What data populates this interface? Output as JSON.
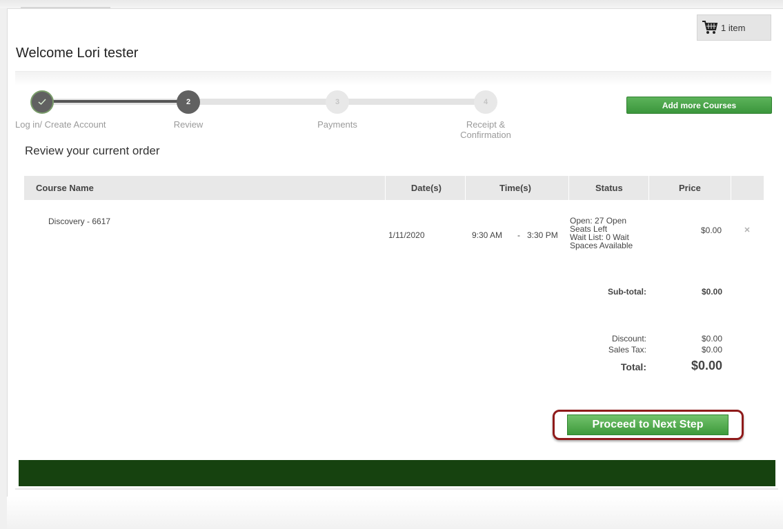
{
  "cart": {
    "count_label": "1 item"
  },
  "welcome": "Welcome Lori tester",
  "steps": [
    {
      "number": "",
      "label": "Log in/ Create Account",
      "state": "done"
    },
    {
      "number": "2",
      "label": "Review",
      "state": "current"
    },
    {
      "number": "3",
      "label": "Payments",
      "state": "todo"
    },
    {
      "number": "4",
      "label_line1": "Receipt &",
      "label_line2": "Confirmation",
      "state": "todo"
    }
  ],
  "add_courses_label": "Add more Courses",
  "review_heading": "Review your current order",
  "table": {
    "headers": [
      "Course Name",
      "Date(s)",
      "Time(s)",
      "Status",
      "Price"
    ],
    "row": {
      "course": "Discovery - 6617",
      "date": "1/11/2020",
      "time_start": "9:30 AM",
      "time_sep": "-",
      "time_end": "3:30 PM",
      "status_lines": [
        "Open: 27 Open",
        "Seats Left",
        "Wait List: 0 Wait",
        "Spaces Available"
      ],
      "price": "$0.00"
    }
  },
  "summary": {
    "subtotal_label": "Sub-total:",
    "subtotal_value": "$0.00",
    "discount_label": "Discount:",
    "discount_value": "$0.00",
    "tax_label": "Sales Tax:",
    "tax_value": "$0.00",
    "total_label": "Total:",
    "total_value": "$0.00"
  },
  "proceed_label": "Proceed to Next Step",
  "colors": {
    "accent_green": "#3b963c",
    "footer_green": "#16420f",
    "highlight_outline": "#8f1a1a"
  }
}
